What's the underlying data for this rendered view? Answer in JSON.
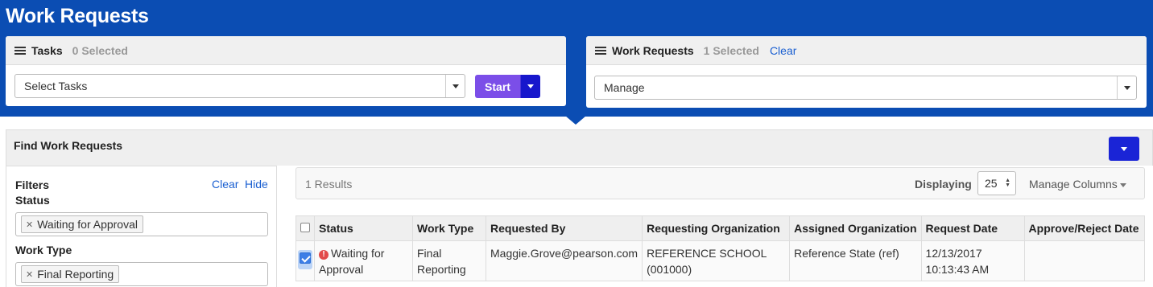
{
  "page": {
    "title": "Work Requests"
  },
  "tasks_panel": {
    "title": "Tasks",
    "selected": "0 Selected",
    "select_placeholder": "Select Tasks",
    "start_label": "Start"
  },
  "requests_panel": {
    "title": "Work Requests",
    "selected": "1 Selected",
    "clear_label": "Clear",
    "action_value": "Manage"
  },
  "find": {
    "title": "Find Work Requests"
  },
  "filters": {
    "title": "Filters",
    "clear_label": "Clear",
    "hide_label": "Hide",
    "status_label": "Status",
    "status_tag": "Waiting for Approval",
    "work_type_label": "Work Type",
    "work_type_tag": "Final Reporting"
  },
  "results": {
    "count": "1 Results",
    "displaying_label": "Displaying",
    "page_size": "25",
    "manage_columns": "Manage Columns"
  },
  "table": {
    "columns": [
      "Status",
      "Work Type",
      "Requested By",
      "Requesting Organization",
      "Assigned Organization",
      "Request Date",
      "Approve/Reject Date"
    ],
    "rows": [
      {
        "status": "Waiting for Approval",
        "work_type": "Final Reporting",
        "requested_by": "Maggie.Grove@pearson.com",
        "requesting_org": "REFERENCE SCHOOL (001000)",
        "assigned_org": "Reference State (ref)",
        "request_date": "12/13/2017 10:13:43 AM",
        "approve_reject_date": ""
      }
    ]
  },
  "colors": {
    "brand": "#0b4db3",
    "start": "#7b4ee8",
    "link": "#1a5fd1",
    "warning": "#e24b4b"
  },
  "icons": [
    "list-icon",
    "caret-down-icon",
    "warning-icon",
    "checkbox-icon",
    "remove-tag-icon"
  ]
}
